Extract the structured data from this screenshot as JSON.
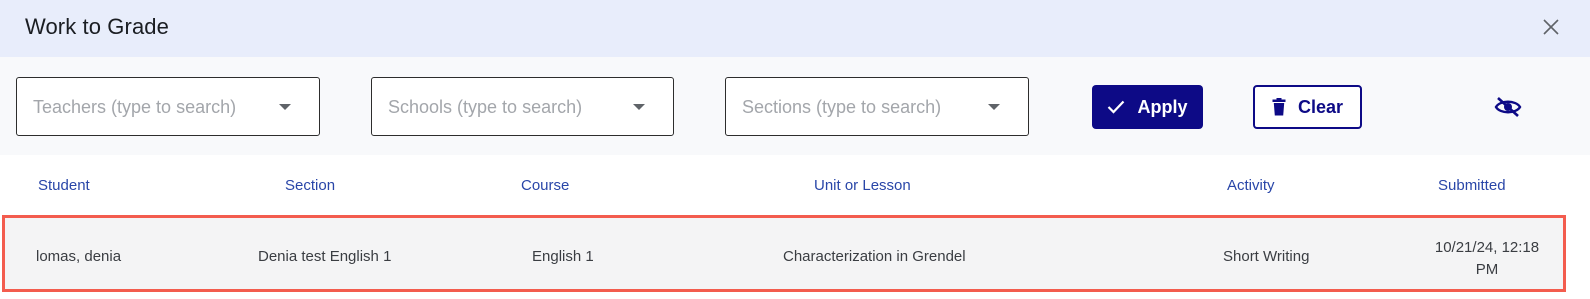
{
  "dialog": {
    "title": "Work to Grade"
  },
  "filters": {
    "teachers_placeholder": "Teachers (type to search)",
    "schools_placeholder": "Schools (type to search)",
    "sections_placeholder": "Sections (type to search)",
    "apply_label": "Apply",
    "clear_label": "Clear"
  },
  "table": {
    "columns": [
      "Student",
      "Section",
      "Course",
      "Unit or Lesson",
      "Activity",
      "Submitted"
    ],
    "rows": [
      {
        "student": "lomas, denia",
        "section": "Denia test English 1",
        "course": "English 1",
        "unit": "Characterization in Grendel",
        "activity": "Short Writing",
        "submitted_line1": "10/21/24, 12:18",
        "submitted_line2": "PM"
      }
    ]
  },
  "colors": {
    "header_bg": "#e8edfb",
    "primary": "#0d0a86",
    "column_header": "#2946a8",
    "highlight_border": "#f35c4e"
  },
  "icons": [
    "close-icon",
    "chevron-down-icon",
    "check-icon",
    "trash-icon",
    "eye-off-icon"
  ]
}
